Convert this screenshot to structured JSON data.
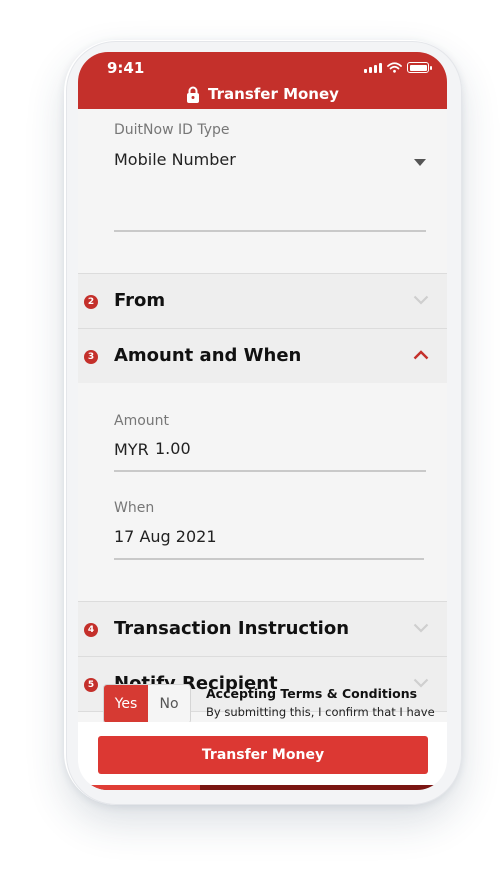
{
  "status_bar": {
    "time": "9:41"
  },
  "header": {
    "title": "Transfer Money",
    "lock_icon": "lock-icon"
  },
  "duitnow": {
    "label": "DuitNow ID Type",
    "value": "Mobile Number"
  },
  "sections": [
    {
      "number": "2",
      "title": "From",
      "expanded": false
    },
    {
      "number": "3",
      "title": "Amount and When",
      "expanded": true
    },
    {
      "number": "4",
      "title": "Transaction Instruction",
      "expanded": false
    },
    {
      "number": "5",
      "title": "Notify Recipient",
      "expanded": false
    }
  ],
  "amount": {
    "label": "Amount",
    "currency": "MYR",
    "value": "1.00"
  },
  "when": {
    "label": "When",
    "value": "17 Aug 2021"
  },
  "terms": {
    "yes_label": "Yes",
    "no_label": "No",
    "selected": "Yes",
    "title": "Accepting Terms & Conditions",
    "body": "By submitting this, I confirm that I have"
  },
  "cta": {
    "label": "Transfer Money"
  },
  "progress": {
    "fraction": 0.33
  },
  "colors": {
    "brand": "#c4302b",
    "button": "#dc3833"
  }
}
